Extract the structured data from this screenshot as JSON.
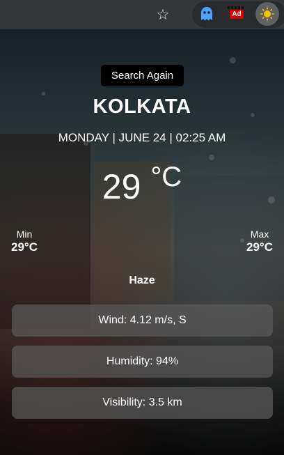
{
  "toolbar": {
    "bookmark_icon": "star-icon",
    "extensions": [
      {
        "name": "ghost-extension",
        "icon": "ghost-icon",
        "color": "#4aa3ff"
      },
      {
        "name": "adblock-extension",
        "icon": "ad-icon",
        "label": "Ad",
        "color": "#d40000"
      },
      {
        "name": "weather-extension",
        "icon": "sun-icon",
        "color": "#f2c200"
      }
    ]
  },
  "weather": {
    "search_again_label": "Search Again",
    "city": "KOLKATA",
    "datetime": "MONDAY | JUNE 24 | 02:25 AM",
    "temperature": "29",
    "unit": "°C",
    "min_label": "Min",
    "min_value": "29°C",
    "max_label": "Max",
    "max_value": "29°C",
    "condition": "Haze",
    "wind": "Wind: 4.12 m/s, S",
    "humidity": "Humidity: 94%",
    "visibility": "Visibility: 3.5 km"
  }
}
